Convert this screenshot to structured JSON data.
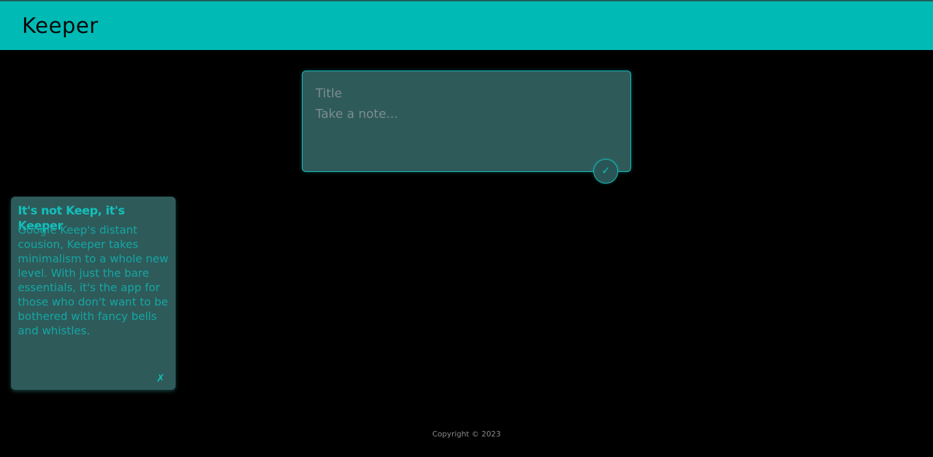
{
  "header": {
    "brand": "Keeper"
  },
  "composer": {
    "title_placeholder": "Title",
    "body_placeholder": "Take a note...",
    "add_icon": "check-icon",
    "add_glyph": "✓"
  },
  "notes": [
    {
      "title": "It's not Keep, it's Keeper",
      "body": "Google Keep's distant cousion, Keeper takes minimalism to a whole new level. With just the bare essentials, it's the app for those who don't want to be bothered with fancy bells and whistles.",
      "delete_icon": "x-icon",
      "delete_glyph": "✗"
    }
  ],
  "footer": {
    "copyright": "Copyright © 2023"
  },
  "colors": {
    "accent": "#00bab5",
    "card": "#2f5a5a",
    "background": "#000000"
  }
}
